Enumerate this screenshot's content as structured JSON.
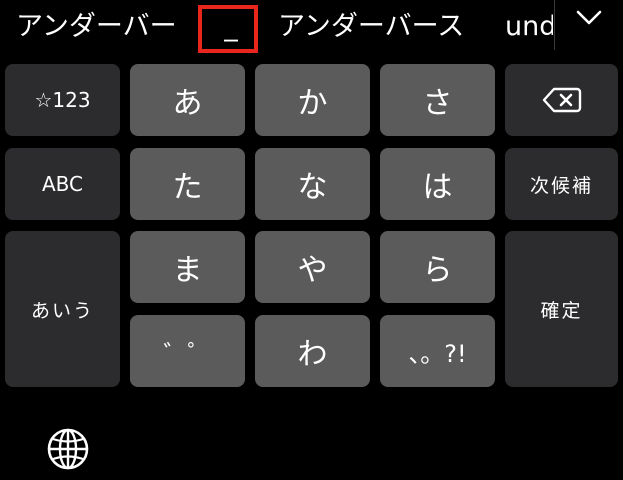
{
  "candidates": {
    "items": [
      "アンダーバー",
      "_",
      "アンダーバース",
      "und"
    ],
    "selected_index": 1,
    "expand_icon": "chevron-down-icon"
  },
  "keyboard": {
    "left_column": {
      "numbers": "☆123",
      "alphabet": "ABC",
      "hiragana": "あいう"
    },
    "kana_keys": {
      "a": "あ",
      "ka": "か",
      "sa": "さ",
      "ta": "た",
      "na": "な",
      "ha": "は",
      "ma": "ま",
      "ya": "や",
      "ra": "ら",
      "dakuten": "゛゜",
      "wa": "わ",
      "punct": "、。?!"
    },
    "right_column": {
      "backspace_icon": "backspace-icon",
      "next_candidate": "次候補",
      "confirm": "確定"
    },
    "globe_icon": "globe-icon"
  },
  "colors": {
    "background": "#000000",
    "key_function": "#2c2c2e",
    "key_kana": "#5b5b5c",
    "highlight": "#e8261d"
  }
}
